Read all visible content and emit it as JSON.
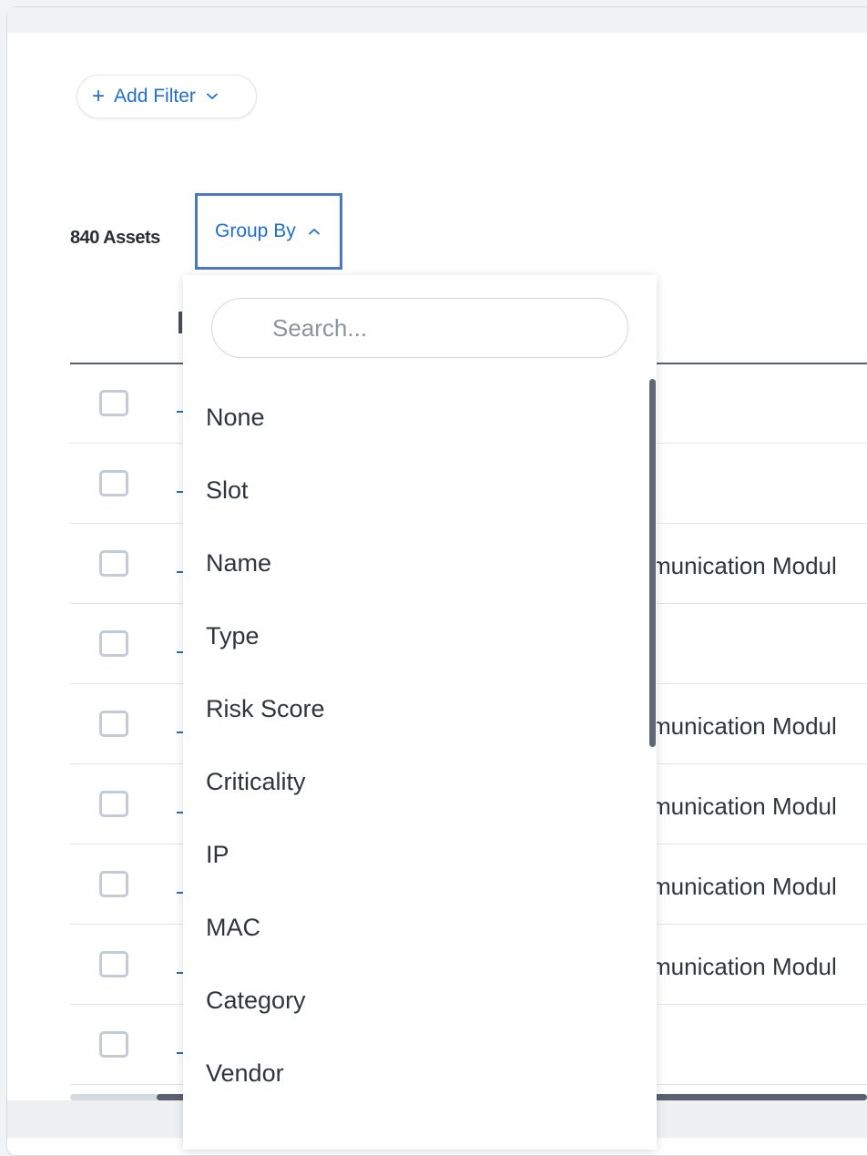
{
  "toolbar": {
    "add_filter": {
      "plus": "+",
      "label": "Add Filter"
    },
    "asset_count": "840 Assets",
    "group_by": {
      "label": "Group By"
    }
  },
  "table": {
    "rows": [
      {
        "visible_text": ""
      },
      {
        "visible_text": ""
      },
      {
        "visible_text": "munication Modul"
      },
      {
        "visible_text": ""
      },
      {
        "visible_text": "munication Modul"
      },
      {
        "visible_text": "munication Modul"
      },
      {
        "visible_text": "munication Modul"
      },
      {
        "visible_text": "munication Modul"
      },
      {
        "visible_text": ""
      }
    ]
  },
  "group_by_dropdown": {
    "search_placeholder": "Search...",
    "options": [
      "None",
      "Slot",
      "Name",
      "Type",
      "Risk Score",
      "Criticality",
      "IP",
      "MAC",
      "Category",
      "Vendor"
    ]
  },
  "icons": {
    "add_filter_chevron": "chevron-down-icon",
    "group_by_chevron": "chevron-up-icon"
  },
  "colors": {
    "accent": "#1f6fd1",
    "focus_border": "#4a78c2",
    "text": "#2f353d"
  }
}
